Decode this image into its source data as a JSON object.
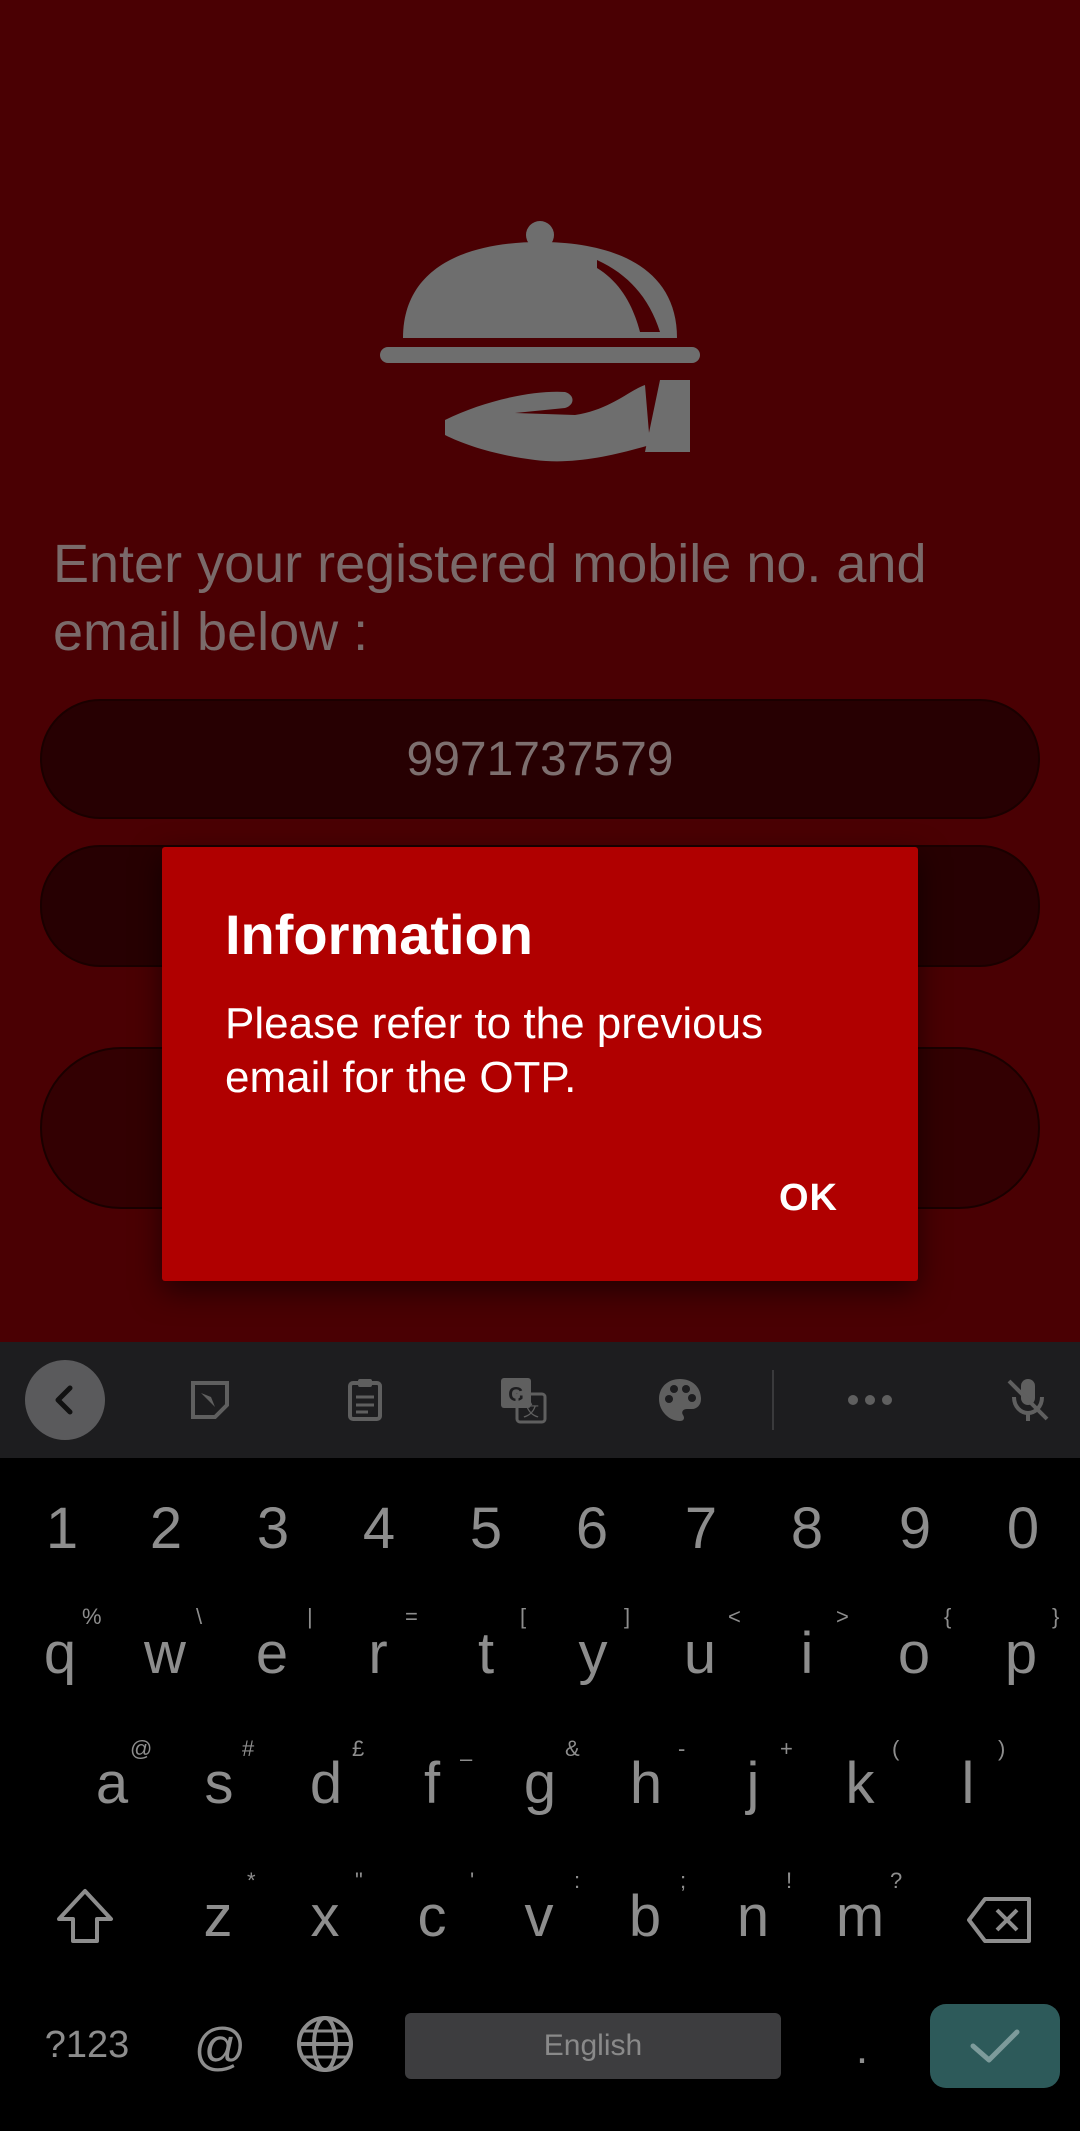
{
  "app": {
    "prompt_text": "Enter your registered mobile no. and email below :",
    "mobile_value": "9971737579",
    "email_value": ""
  },
  "dialog": {
    "title": "Information",
    "message": "Please refer to the previous email for the OTP.",
    "ok_label": "OK"
  },
  "toolbar": {
    "icons": [
      "back-icon",
      "sticker-icon",
      "clipboard-icon",
      "translate-icon",
      "palette-icon",
      "more-icon",
      "mic-off-icon"
    ]
  },
  "keyboard": {
    "numbers": [
      "1",
      "2",
      "3",
      "4",
      "5",
      "6",
      "7",
      "8",
      "9",
      "0"
    ],
    "row1": [
      "q",
      "w",
      "e",
      "r",
      "t",
      "y",
      "u",
      "i",
      "o",
      "p"
    ],
    "row1_sup": [
      "%",
      "\\",
      "|",
      "=",
      "[",
      "]",
      "<",
      ">",
      "{",
      "}"
    ],
    "row2": [
      "a",
      "s",
      "d",
      "f",
      "g",
      "h",
      "j",
      "k",
      "l"
    ],
    "row2_sup": [
      "@",
      "#",
      "£",
      "–",
      "&",
      "-",
      "+",
      "(",
      ")"
    ],
    "row3": [
      "z",
      "x",
      "c",
      "v",
      "b",
      "n",
      "m"
    ],
    "row3_sup": [
      "*",
      "\"",
      "'",
      ":",
      ";",
      "!",
      "?"
    ],
    "symbols_label": "?123",
    "at_label": "@",
    "space_label": "English",
    "period_label": "."
  }
}
